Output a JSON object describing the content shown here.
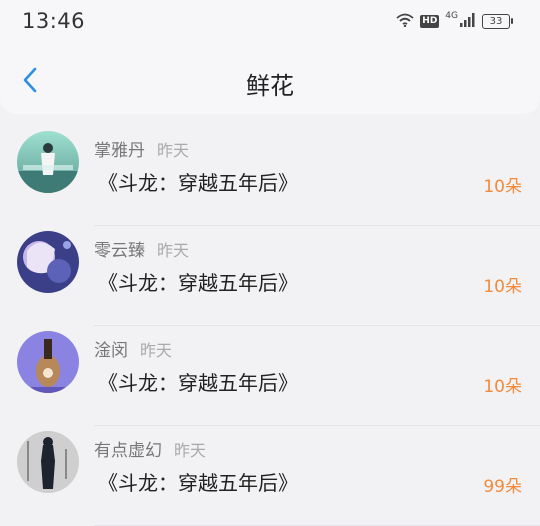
{
  "status_bar": {
    "time": "13:46",
    "hd_label": "HD",
    "network_label": "4G",
    "battery": "33"
  },
  "header": {
    "back_icon": "chevron-left-icon",
    "title": "鲜花"
  },
  "records": [
    {
      "user": "掌雅丹",
      "time": "昨天",
      "book": "《斗龙：穿越五年后》",
      "count": "10朵"
    },
    {
      "user": "零云臻",
      "time": "昨天",
      "book": "《斗龙：穿越五年后》",
      "count": "10朵"
    },
    {
      "user": "淦闵",
      "time": "昨天",
      "book": "《斗龙：穿越五年后》",
      "count": "10朵"
    },
    {
      "user": "有点虚幻",
      "time": "昨天",
      "book": "《斗龙：穿越五年后》",
      "count": "99朵"
    }
  ],
  "colors": {
    "accent": "#2d8ee8",
    "count": "#f28a3c"
  }
}
